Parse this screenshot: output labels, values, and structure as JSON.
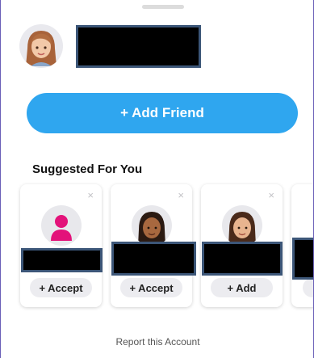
{
  "add_friend_label": "+ Add Friend",
  "suggested": {
    "title": "Suggested For You",
    "cards": [
      {
        "action": "+ Accept",
        "close": "×",
        "avatar": "default-silhouette"
      },
      {
        "action": "+ Accept",
        "close": "×",
        "avatar": "bitmoji"
      },
      {
        "action": "+ Add",
        "close": "×",
        "avatar": "bitmoji"
      }
    ]
  },
  "report_label": "Report this Account",
  "colors": {
    "accent": "#2fa6ef",
    "silhouette": "#e3127a",
    "redaction_border": "#3c5678"
  }
}
